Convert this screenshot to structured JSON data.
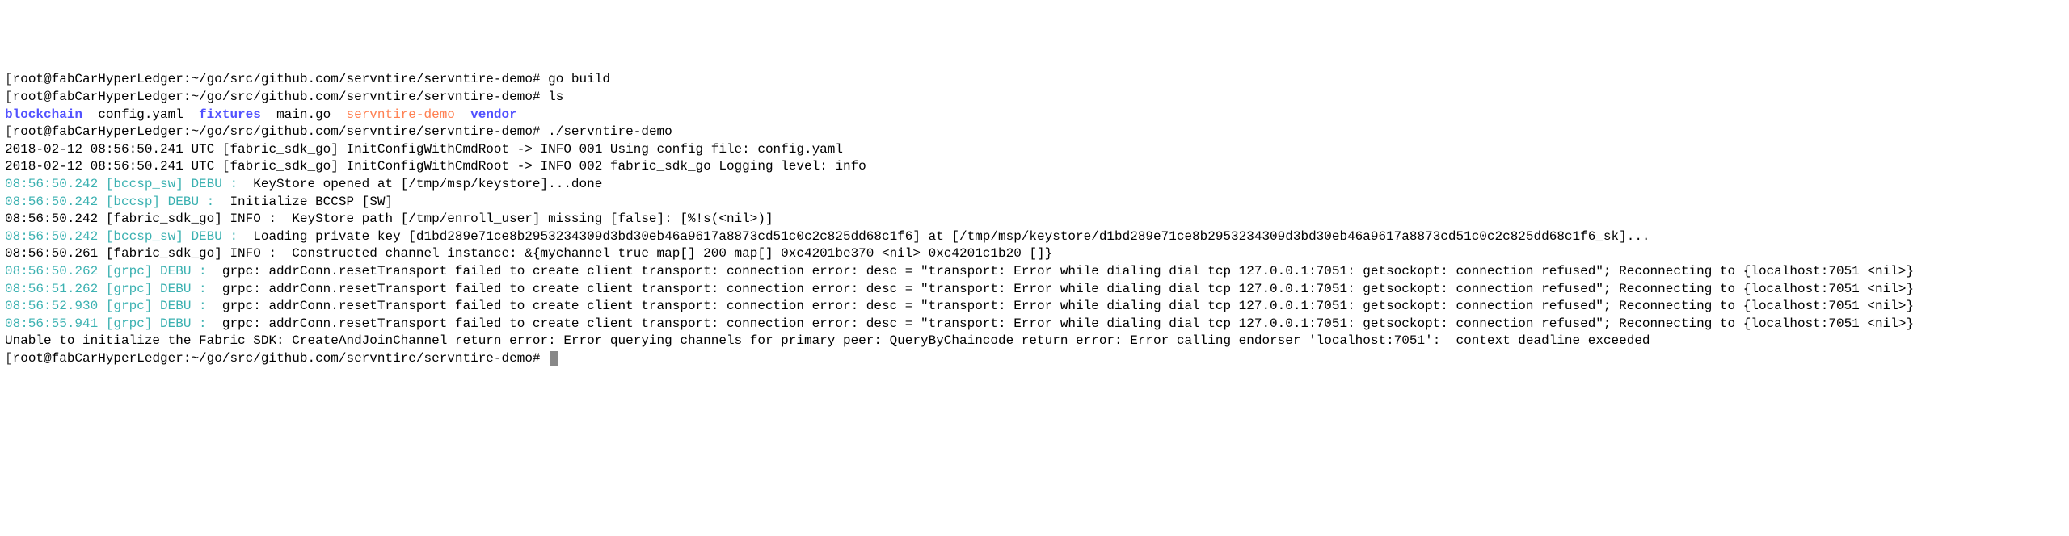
{
  "lines": [
    {
      "segments": [
        {
          "t": "[",
          "cls": "prompt-bracket"
        },
        {
          "t": "root@fabCarHyperLedger:~/go/src/github.com/servntire/servntire-demo# go build"
        }
      ]
    },
    {
      "segments": [
        {
          "t": "[",
          "cls": "prompt-bracket"
        },
        {
          "t": "root@fabCarHyperLedger:~/go/src/github.com/servntire/servntire-demo# ls"
        }
      ]
    },
    {
      "segments": [
        {
          "t": "blockchain",
          "cls": "dir-blue"
        },
        {
          "t": "  config.yaml  "
        },
        {
          "t": "fixtures",
          "cls": "dir-blue"
        },
        {
          "t": "  main.go  "
        },
        {
          "t": "servntire-demo",
          "cls": "exe-orange"
        },
        {
          "t": "  "
        },
        {
          "t": "vendor",
          "cls": "dir-blue"
        }
      ]
    },
    {
      "segments": [
        {
          "t": "[",
          "cls": "prompt-bracket"
        },
        {
          "t": "root@fabCarHyperLedger:~/go/src/github.com/servntire/servntire-demo# ./servntire-demo"
        }
      ]
    },
    {
      "segments": [
        {
          "t": "2018-02-12 08:56:50.241 UTC [fabric_sdk_go] InitConfigWithCmdRoot -> INFO 001 Using config file: config.yaml"
        }
      ]
    },
    {
      "segments": [
        {
          "t": "2018-02-12 08:56:50.241 UTC [fabric_sdk_go] InitConfigWithCmdRoot -> INFO 002 fabric_sdk_go Logging level: info"
        }
      ]
    },
    {
      "segments": [
        {
          "t": "08:56:50.242 [bccsp_sw] DEBU :",
          "cls": "time-teal"
        },
        {
          "t": "  KeyStore opened at [/tmp/msp/keystore]...done"
        }
      ]
    },
    {
      "segments": [
        {
          "t": "08:56:50.242 [bccsp] DEBU :",
          "cls": "time-teal"
        },
        {
          "t": "  Initialize BCCSP [SW]"
        }
      ]
    },
    {
      "segments": [
        {
          "t": "08:56:50.242 [fabric_sdk_go] INFO :  KeyStore path [/tmp/enroll_user] missing [false]: [%!s(<nil>)]"
        }
      ]
    },
    {
      "segments": [
        {
          "t": "08:56:50.242 [bccsp_sw] DEBU :",
          "cls": "time-teal"
        },
        {
          "t": "  Loading private key [d1bd289e71ce8b2953234309d3bd30eb46a9617a8873cd51c0c2c825dd68c1f6] at [/tmp/msp/keystore/d1bd289e71ce8b2953234309d3bd30eb46a9617a8873cd51c0c2c825dd68c1f6_sk]..."
        }
      ]
    },
    {
      "segments": [
        {
          "t": "08:56:50.261 [fabric_sdk_go] INFO :  Constructed channel instance: &{mychannel true map[] 200 map[] 0xc4201be370 <nil> 0xc4201c1b20 []}"
        }
      ]
    },
    {
      "segments": [
        {
          "t": "08:56:50.262 [grpc] DEBU :",
          "cls": "time-teal"
        },
        {
          "t": "  grpc: addrConn.resetTransport failed to create client transport: connection error: desc = \"transport: Error while dialing dial tcp 127.0.0.1:7051: getsockopt: connection refused\"; Reconnecting to {localhost:7051 <nil>}"
        }
      ]
    },
    {
      "segments": [
        {
          "t": "08:56:51.262 [grpc] DEBU :",
          "cls": "time-teal"
        },
        {
          "t": "  grpc: addrConn.resetTransport failed to create client transport: connection error: desc = \"transport: Error while dialing dial tcp 127.0.0.1:7051: getsockopt: connection refused\"; Reconnecting to {localhost:7051 <nil>}"
        }
      ]
    },
    {
      "segments": [
        {
          "t": "08:56:52.930 [grpc] DEBU :",
          "cls": "time-teal"
        },
        {
          "t": "  grpc: addrConn.resetTransport failed to create client transport: connection error: desc = \"transport: Error while dialing dial tcp 127.0.0.1:7051: getsockopt: connection refused\"; Reconnecting to {localhost:7051 <nil>}"
        }
      ]
    },
    {
      "segments": [
        {
          "t": "08:56:55.941 [grpc] DEBU :",
          "cls": "time-teal"
        },
        {
          "t": "  grpc: addrConn.resetTransport failed to create client transport: connection error: desc = \"transport: Error while dialing dial tcp 127.0.0.1:7051: getsockopt: connection refused\"; Reconnecting to {localhost:7051 <nil>}"
        }
      ]
    },
    {
      "segments": [
        {
          "t": "Unable to initialize the Fabric SDK: CreateAndJoinChannel return error: Error querying channels for primary peer: QueryByChaincode return error: Error calling endorser 'localhost:7051':  context deadline exceeded"
        }
      ]
    },
    {
      "segments": [
        {
          "t": "[",
          "cls": "prompt-bracket"
        },
        {
          "t": "root@fabCarHyperLedger:~/go/src/github.com/servntire/servntire-demo# "
        },
        {
          "t": "",
          "cursor": true
        }
      ]
    }
  ]
}
